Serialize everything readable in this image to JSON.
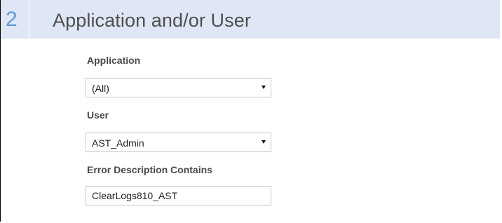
{
  "section": {
    "number": "2",
    "title": "Application and/or User"
  },
  "fields": {
    "application": {
      "label": "Application",
      "value": "(All)"
    },
    "user": {
      "label": "User",
      "value": "AST_Admin"
    },
    "error_description": {
      "label": "Error Description Contains",
      "value": "ClearLogs810_AST"
    }
  },
  "icons": {
    "dropdown": "chevron-down-icon"
  },
  "colors": {
    "header_background": "#dfe6f5",
    "step_number": "#5b9bd5",
    "title_text": "#4f4f4f",
    "label_text": "#4a4a4a",
    "input_border": "#c6c6c6"
  }
}
